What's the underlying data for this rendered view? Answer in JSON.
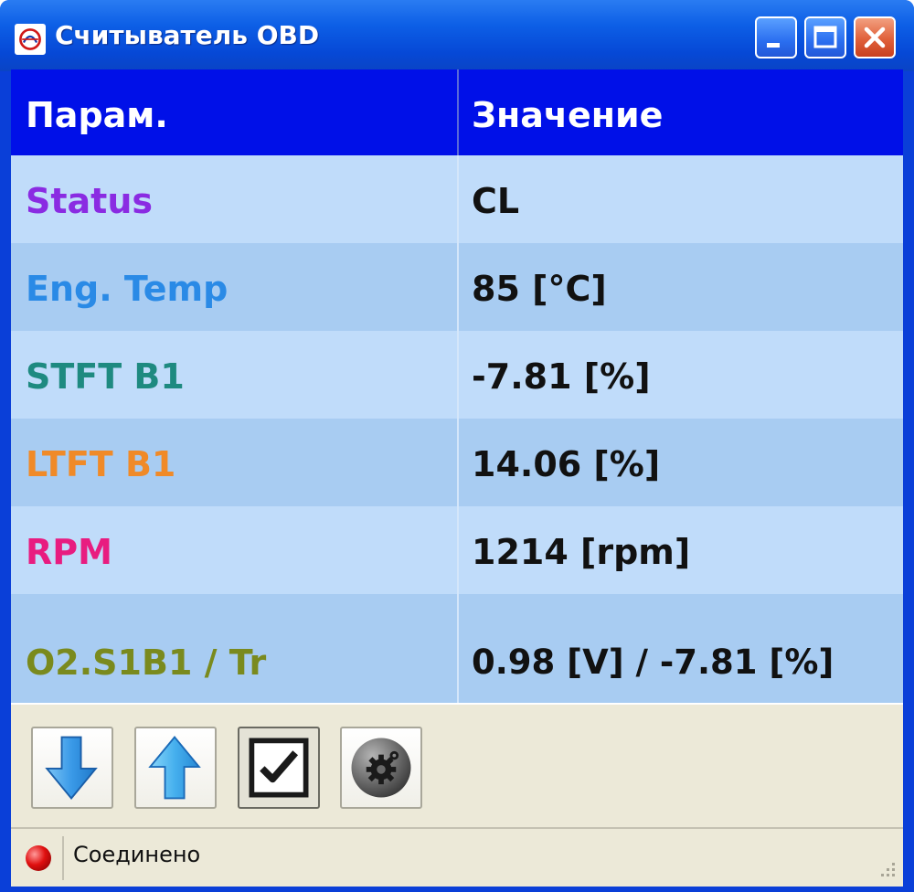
{
  "window": {
    "title": "Считыватель OBD"
  },
  "grid": {
    "headers": {
      "param": "Парам.",
      "value": "Значение"
    },
    "rows": [
      {
        "param": "Status",
        "value": "CL",
        "color": "#8a2be2"
      },
      {
        "param": "Eng. Temp",
        "value": "85 [°C]",
        "color": "#2a8ae6"
      },
      {
        "param": "STFT B1",
        "value": "-7.81 [%]",
        "color": "#1e8a80"
      },
      {
        "param": "LTFT B1",
        "value": "14.06 [%]",
        "color": "#f08a28"
      },
      {
        "param": "RPM",
        "value": "1214 [rpm]",
        "color": "#e81c80"
      },
      {
        "param": "O2.S1B1 / Tr",
        "value": "0.98 [V] / -7.81 [%]",
        "color": "#7a8a1e"
      }
    ]
  },
  "toolbar": {
    "buttons": [
      {
        "icon": "arrow-down-icon"
      },
      {
        "icon": "arrow-up-icon"
      },
      {
        "icon": "checkmark-icon"
      },
      {
        "icon": "gear-icon"
      }
    ]
  },
  "status": {
    "text": "Соединено",
    "indicator_color": "#e01010"
  }
}
